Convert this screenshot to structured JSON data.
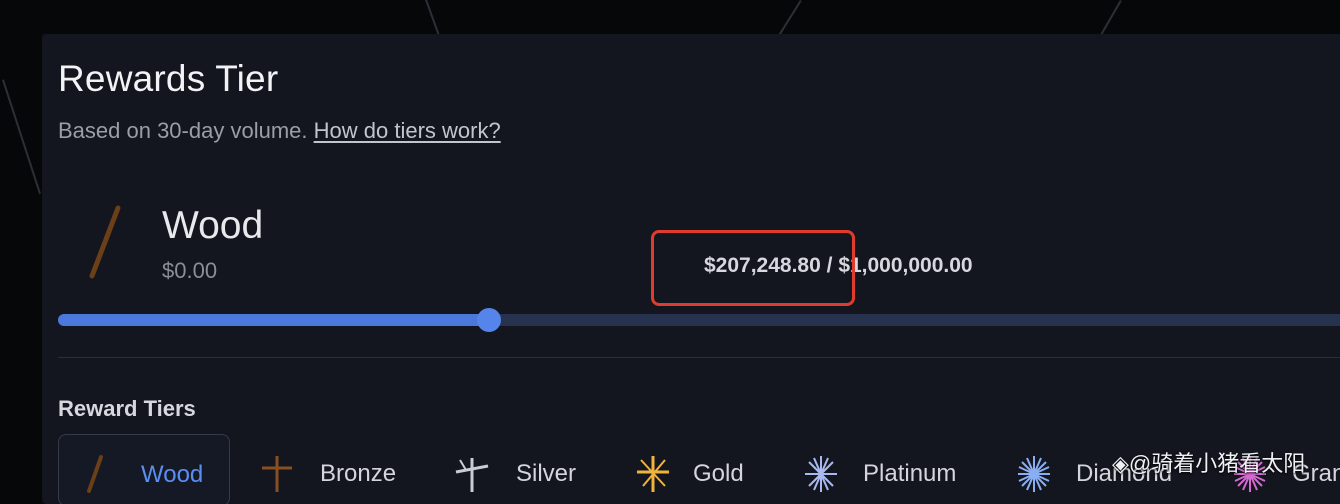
{
  "header": {
    "title": "Rewards Tier",
    "subtitle": "Based on 30-day volume.",
    "help_link": "How do tiers work?"
  },
  "current_tier": {
    "name": "Wood",
    "min_volume": "$0.00",
    "icon": "wood-stick-icon"
  },
  "progress": {
    "current": "$207,248.80",
    "separator": " / ",
    "target": "$1,000,000.00",
    "fraction": 0.2072488
  },
  "tiers_section": {
    "title": "Reward Tiers",
    "tiers": [
      {
        "label": "Wood",
        "icon": "wood-icon",
        "active": true
      },
      {
        "label": "Bronze",
        "icon": "bronze-cross-icon",
        "active": false
      },
      {
        "label": "Silver",
        "icon": "silver-star-icon",
        "active": false
      },
      {
        "label": "Gold",
        "icon": "gold-star-icon",
        "active": false
      },
      {
        "label": "Platinum",
        "icon": "platinum-burst-icon",
        "active": false
      },
      {
        "label": "Diamond",
        "icon": "diamond-burst-icon",
        "active": false
      },
      {
        "label": "Grand",
        "icon": "grand-burst-icon",
        "active": false
      }
    ]
  },
  "watermark": "◈@骑着小猪看太阳",
  "colors": {
    "accent": "#4c78dc",
    "highlight": "#e03c2d",
    "card": "#13151f"
  }
}
